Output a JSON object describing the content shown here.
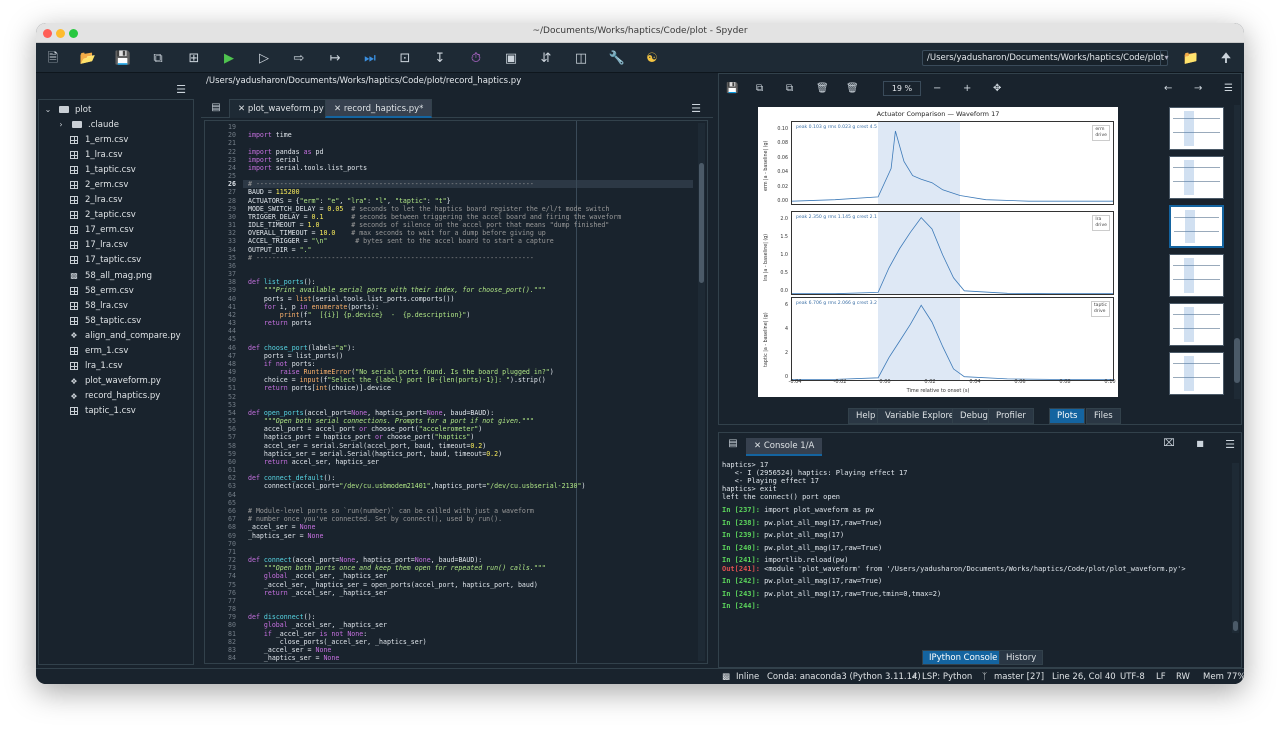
{
  "window": {
    "title": "~/Documents/Works/haptics/Code/plot - Spyder"
  },
  "toolbar": {
    "icons": [
      "new-file-icon",
      "open-file-icon",
      "save-icon",
      "save-all-icon",
      "new-cell-icon",
      "run-icon",
      "run-cell-icon",
      "run-cell-advance-icon",
      "run-selection-icon",
      "debug-icon",
      "debug-cell-icon",
      "debug-selection-icon",
      "profile-icon",
      "run-config-icon",
      "debug-step-icon",
      "maximize-pane-icon",
      "preferences-icon",
      "python-path-icon"
    ],
    "path": "/Users/yadusharon/Documents/Works/haptics/Code/plot"
  },
  "files": {
    "root": "plot",
    "items": [
      {
        "name": ".claude",
        "type": "folder"
      },
      {
        "name": "1_erm.csv",
        "type": "csv"
      },
      {
        "name": "1_lra.csv",
        "type": "csv"
      },
      {
        "name": "1_taptic.csv",
        "type": "csv"
      },
      {
        "name": "2_erm.csv",
        "type": "csv"
      },
      {
        "name": "2_lra.csv",
        "type": "csv"
      },
      {
        "name": "2_taptic.csv",
        "type": "csv"
      },
      {
        "name": "17_erm.csv",
        "type": "csv"
      },
      {
        "name": "17_lra.csv",
        "type": "csv"
      },
      {
        "name": "17_taptic.csv",
        "type": "csv"
      },
      {
        "name": "58_all_mag.png",
        "type": "image"
      },
      {
        "name": "58_erm.csv",
        "type": "csv"
      },
      {
        "name": "58_lra.csv",
        "type": "csv"
      },
      {
        "name": "58_taptic.csv",
        "type": "csv"
      },
      {
        "name": "align_and_compare.py",
        "type": "py"
      },
      {
        "name": "erm_1.csv",
        "type": "csv"
      },
      {
        "name": "lra_1.csv",
        "type": "csv"
      },
      {
        "name": "plot_waveform.py",
        "type": "py"
      },
      {
        "name": "record_haptics.py",
        "type": "py"
      },
      {
        "name": "taptic_1.csv",
        "type": "csv"
      }
    ]
  },
  "editor": {
    "path": "/Users/yadusharon/Documents/Works/haptics/Code/plot/record_haptics.py",
    "tabs": [
      {
        "label": "plot_waveform.py",
        "active": false
      },
      {
        "label": "record_haptics.py*",
        "active": true
      }
    ],
    "current_line": 26,
    "lines": [
      {
        "n": 19,
        "t": ""
      },
      {
        "n": 20,
        "t": "import time"
      },
      {
        "n": 21,
        "t": ""
      },
      {
        "n": 22,
        "t": "import pandas as pd"
      },
      {
        "n": 23,
        "t": "import serial"
      },
      {
        "n": 24,
        "t": "import serial.tools.list_ports"
      },
      {
        "n": 25,
        "t": ""
      },
      {
        "n": 26,
        "t": "# ----------------------------------------------------------------------"
      },
      {
        "n": 27,
        "t": "BAUD = 115200"
      },
      {
        "n": 28,
        "t": "ACTUATORS = {\"erm\": \"e\", \"lra\": \"l\", \"taptic\": \"t\"}"
      },
      {
        "n": 29,
        "t": "MODE_SWITCH_DELAY = 0.05  # seconds to let the haptics board register the e/l/t mode switch"
      },
      {
        "n": 30,
        "t": "TRIGGER_DELAY = 0.1       # seconds between triggering the accel board and firing the waveform"
      },
      {
        "n": 31,
        "t": "IDLE_TIMEOUT = 1.0        # seconds of silence on the accel port that means \"dump finished\""
      },
      {
        "n": 32,
        "t": "OVERALL_TIMEOUT = 10.0    # max seconds to wait for a dump before giving up"
      },
      {
        "n": 33,
        "t": "ACCEL_TRIGGER = \"\\n\"       # bytes sent to the accel board to start a capture"
      },
      {
        "n": 34,
        "t": "OUTPUT_DIR = \".\""
      },
      {
        "n": 35,
        "t": "# ----------------------------------------------------------------------"
      },
      {
        "n": 36,
        "t": ""
      },
      {
        "n": 37,
        "t": ""
      },
      {
        "n": 38,
        "t": "def list_ports():"
      },
      {
        "n": 39,
        "t": "    \"\"\"Print available serial ports with their index, for choose_port().\"\"\""
      },
      {
        "n": 40,
        "t": "    ports = list(serial.tools.list_ports.comports())"
      },
      {
        "n": 41,
        "t": "    for i, p in enumerate(ports):"
      },
      {
        "n": 42,
        "t": "        print(f\"  [{i}] {p.device}  -  {p.description}\")"
      },
      {
        "n": 43,
        "t": "    return ports"
      },
      {
        "n": 44,
        "t": ""
      },
      {
        "n": 45,
        "t": ""
      },
      {
        "n": 46,
        "t": "def choose_port(label=\"a\"):"
      },
      {
        "n": 47,
        "t": "    ports = list_ports()"
      },
      {
        "n": 48,
        "t": "    if not ports:"
      },
      {
        "n": 49,
        "t": "        raise RuntimeError(\"No serial ports found. Is the board plugged in?\")"
      },
      {
        "n": 50,
        "t": "    choice = input(f\"Select the {label} port [0-{len(ports)-1}]: \").strip()"
      },
      {
        "n": 51,
        "t": "    return ports[int(choice)].device"
      },
      {
        "n": 52,
        "t": ""
      },
      {
        "n": 53,
        "t": ""
      },
      {
        "n": 54,
        "t": "def open_ports(accel_port=None, haptics_port=None, baud=BAUD):"
      },
      {
        "n": 55,
        "t": "    \"\"\"Open both serial connections. Prompts for a port if not given.\"\"\""
      },
      {
        "n": 56,
        "t": "    accel_port = accel_port or choose_port(\"accelerometer\")"
      },
      {
        "n": 57,
        "t": "    haptics_port = haptics_port or choose_port(\"haptics\")"
      },
      {
        "n": 58,
        "t": "    accel_ser = serial.Serial(accel_port, baud, timeout=0.2)"
      },
      {
        "n": 59,
        "t": "    haptics_ser = serial.Serial(haptics_port, baud, timeout=0.2)"
      },
      {
        "n": 60,
        "t": "    return accel_ser, haptics_ser"
      },
      {
        "n": 61,
        "t": ""
      },
      {
        "n": 62,
        "t": "def connect_default():"
      },
      {
        "n": 63,
        "t": "    connect(accel_port=\"/dev/cu.usbmodem21401\",haptics_port=\"/dev/cu.usbserial-2130\")"
      },
      {
        "n": 64,
        "t": ""
      },
      {
        "n": 65,
        "t": ""
      },
      {
        "n": 66,
        "t": "# Module-level ports so `run(number)` can be called with just a waveform"
      },
      {
        "n": 67,
        "t": "# number once you've connected. Set by connect(), used by run()."
      },
      {
        "n": 68,
        "t": "_accel_ser = None"
      },
      {
        "n": 69,
        "t": "_haptics_ser = None"
      },
      {
        "n": 70,
        "t": ""
      },
      {
        "n": 71,
        "t": ""
      },
      {
        "n": 72,
        "t": "def connect(accel_port=None, haptics_port=None, baud=BAUD):"
      },
      {
        "n": 73,
        "t": "    \"\"\"Open both ports once and keep them open for repeated run() calls.\"\"\""
      },
      {
        "n": 74,
        "t": "    global _accel_ser, _haptics_ser"
      },
      {
        "n": 75,
        "t": "    _accel_ser, _haptics_ser = open_ports(accel_port, haptics_port, baud)"
      },
      {
        "n": 76,
        "t": "    return _accel_ser, _haptics_ser"
      },
      {
        "n": 77,
        "t": ""
      },
      {
        "n": 78,
        "t": ""
      },
      {
        "n": 79,
        "t": "def disconnect():"
      },
      {
        "n": 80,
        "t": "    global _accel_ser, _haptics_ser"
      },
      {
        "n": 81,
        "t": "    if _accel_ser is not None:"
      },
      {
        "n": 82,
        "t": "        close_ports(_accel_ser, _haptics_ser)"
      },
      {
        "n": 83,
        "t": "    _accel_ser = None"
      },
      {
        "n": 84,
        "t": "    _haptics_ser = None"
      }
    ]
  },
  "plots": {
    "zoom": "19 %",
    "pane_tabs": [
      "Help",
      "Variable Explorer",
      "Debugger",
      "Profiler",
      "Plots",
      "Files"
    ],
    "active_tab": "Plots",
    "thumbnail_count": 6,
    "selected_thumbnail": 3
  },
  "chart_data": {
    "type": "line",
    "title": "Actuator Comparison — Waveform 17",
    "xlabel": "Time relative to onset (s)",
    "xlim": [
      -0.04,
      0.11
    ],
    "xticks": [
      "-0.04",
      "-0.02",
      "0.00",
      "0.02",
      "0.04",
      "0.06",
      "0.08",
      "0.10"
    ],
    "highlight_x": [
      0.0,
      0.038
    ],
    "subplots": [
      {
        "ylabel": "erm\n|a - baseline| (g)",
        "annotation": "peak 0.103 g   rms 0.023 g   crest 4.5",
        "legend": [
          "erm",
          "drive"
        ],
        "yticks": [
          "0.10",
          "0.08",
          "0.06",
          "0.04",
          "0.02",
          "0.00"
        ],
        "ylim": [
          0,
          0.11
        ],
        "x": [
          -0.04,
          -0.02,
          0.0,
          0.006,
          0.008,
          0.012,
          0.016,
          0.02,
          0.025,
          0.03,
          0.038,
          0.05,
          0.07,
          0.09,
          0.11
        ],
        "y": [
          0.004,
          0.006,
          0.01,
          0.05,
          0.103,
          0.06,
          0.04,
          0.035,
          0.03,
          0.02,
          0.012,
          0.006,
          0.004,
          0.004,
          0.004
        ]
      },
      {
        "ylabel": "lra\n|a - baseline| (g)",
        "annotation": "peak 2.350 g   rms 1.145 g   crest 2.1",
        "legend": [
          "lra",
          "drive"
        ],
        "yticks": [
          "2.0",
          "1.5",
          "1.0",
          "0.5",
          "0.0"
        ],
        "ylim": [
          0,
          2.4
        ],
        "x": [
          -0.04,
          -0.02,
          0.0,
          0.005,
          0.01,
          0.015,
          0.02,
          0.025,
          0.03,
          0.035,
          0.04,
          0.06,
          0.08,
          0.11
        ],
        "y": [
          0.01,
          0.01,
          0.05,
          0.8,
          1.4,
          1.9,
          2.35,
          2.0,
          1.2,
          0.5,
          0.1,
          0.02,
          0.01,
          0.01
        ]
      },
      {
        "ylabel": "taptic\n|a - baseline| (g)",
        "annotation": "peak 6.706 g   rms 2.066 g   crest 3.2",
        "legend": [
          "taptic",
          "drive"
        ],
        "yticks": [
          "6",
          "4",
          "2",
          "0"
        ],
        "ylim": [
          0,
          7
        ],
        "x": [
          -0.04,
          -0.02,
          0.0,
          0.005,
          0.01,
          0.015,
          0.02,
          0.025,
          0.03,
          0.035,
          0.04,
          0.06,
          0.08,
          0.11
        ],
        "y": [
          0.05,
          0.05,
          0.2,
          2.0,
          3.5,
          5.0,
          6.7,
          5.2,
          3.0,
          1.0,
          0.3,
          0.1,
          0.05,
          0.05
        ]
      }
    ]
  },
  "console": {
    "tab": "Console 1/A",
    "lines": [
      {
        "k": "txt",
        "t": "haptics> 17"
      },
      {
        "k": "txt",
        "t": "   <- I (2956524) haptics: Playing effect 17"
      },
      {
        "k": "txt",
        "t": "   <- Playing effect 17"
      },
      {
        "k": "txt",
        "t": "haptics> exit"
      },
      {
        "k": "txt",
        "t": "left the connect() port open"
      },
      {
        "k": "gap",
        "t": ""
      },
      {
        "k": "in",
        "p": "In [237]: ",
        "t": "import plot_waveform as pw"
      },
      {
        "k": "gap",
        "t": ""
      },
      {
        "k": "in",
        "p": "In [238]: ",
        "t": "pw.plot_all_mag(17,raw=True)"
      },
      {
        "k": "gap",
        "t": ""
      },
      {
        "k": "in",
        "p": "In [239]: ",
        "t": "pw.plot_all_mag(17)"
      },
      {
        "k": "gap",
        "t": ""
      },
      {
        "k": "in",
        "p": "In [240]: ",
        "t": "pw.plot_all_mag(17,raw=True)"
      },
      {
        "k": "gap",
        "t": ""
      },
      {
        "k": "in",
        "p": "In [241]: ",
        "t": "importlib.reload(pw)"
      },
      {
        "k": "out",
        "p": "Out[241]: ",
        "t": "<module 'plot_waveform' from '/Users/yadusharon/Documents/Works/haptics/Code/plot/plot_waveform.py'>"
      },
      {
        "k": "gap",
        "t": ""
      },
      {
        "k": "in",
        "p": "In [242]: ",
        "t": "pw.plot_all_mag(17,raw=True)"
      },
      {
        "k": "gap",
        "t": ""
      },
      {
        "k": "in",
        "p": "In [243]: ",
        "t": "pw.plot_all_mag(17,raw=True,tmin=0,tmax=2)"
      },
      {
        "k": "gap",
        "t": ""
      },
      {
        "k": "in",
        "p": "In [244]: ",
        "t": ""
      }
    ],
    "bottom_tabs": [
      "IPython Console",
      "History"
    ],
    "active_bottom": "IPython Console"
  },
  "status": {
    "inline": "Inline",
    "env": "Conda: anaconda3 (Python 3.11.14)",
    "lsp": "LSP: Python",
    "git": "master [27]",
    "cursor": "Line 26, Col 40",
    "encoding": "UTF-8",
    "eol": "LF",
    "rw": "RW",
    "mem": "Mem 77%"
  }
}
